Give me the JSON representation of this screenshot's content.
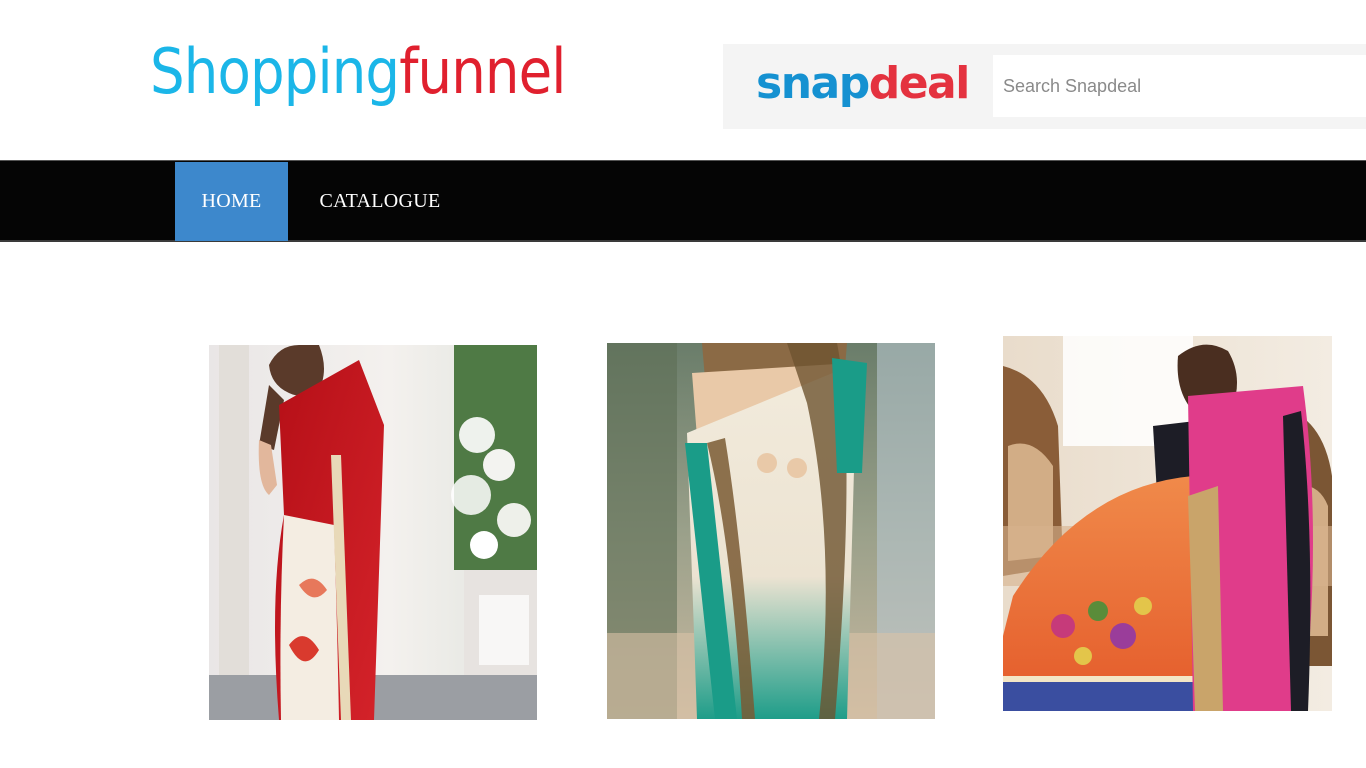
{
  "header": {
    "logo": {
      "part1": "Shopping",
      "part2": "funnel"
    },
    "brand": {
      "part1": "snap",
      "part2": "deal"
    },
    "search": {
      "placeholder": "Search Snapdeal",
      "value": ""
    }
  },
  "nav": {
    "items": [
      {
        "label": "HOME",
        "active": true
      },
      {
        "label": "CATALOGUE",
        "active": false
      }
    ]
  },
  "products": [
    {
      "image": "red-saree-photo",
      "colors": [
        "#c8141c",
        "#f2ede4",
        "#6f8f5a"
      ]
    },
    {
      "image": "cream-teal-saree-photo",
      "colors": [
        "#efe6d6",
        "#1a9c88",
        "#8a6a3a"
      ]
    },
    {
      "image": "pink-orange-saree-photo",
      "colors": [
        "#e23e8c",
        "#ec6a3a",
        "#c9a27a"
      ]
    }
  ],
  "colors": {
    "logo_blue": "#1bb6e8",
    "logo_red": "#e0202e",
    "nav_bg": "#050505",
    "nav_active": "#3d88cc"
  }
}
